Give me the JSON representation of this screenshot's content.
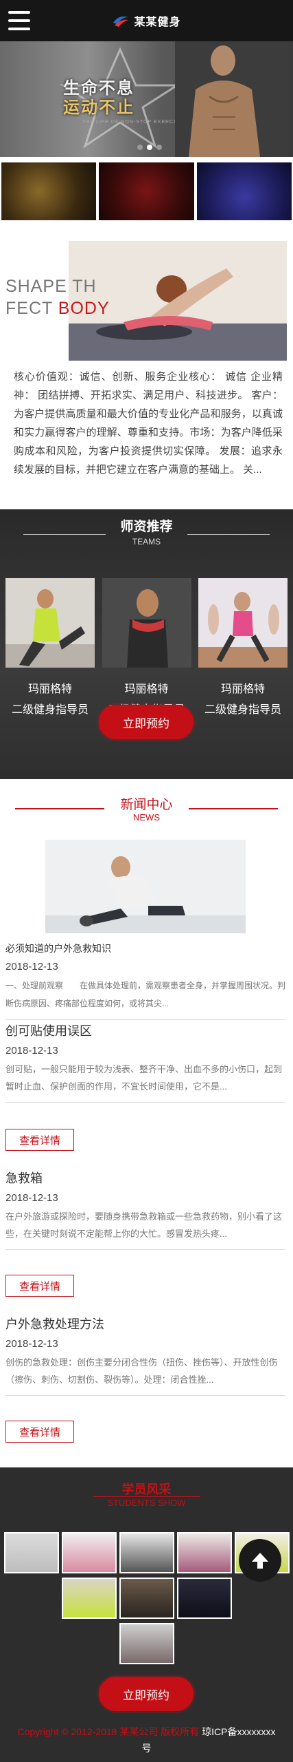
{
  "header": {
    "brand": "某某健身",
    "menu_icon": "hamburger-icon",
    "logo_icon": "swoosh-logo-icon"
  },
  "banner": {
    "title": "生命不息",
    "subtitle": "运动不止",
    "small_text": "THE LIFE OF NON-STOP EXERCISE",
    "slides": 3,
    "active_slide": 2
  },
  "shape": {
    "en_line1_a": "SHAPE TH",
    "en_line2_a": "FECT ",
    "en_line2_b": "BODY"
  },
  "about": {
    "text": "核心价值观：诚信、创新、服务企业核心： 诚信 企业精神： 团结拼搏、开拓求实、满足用户、科技进步。 客户：为客户提供高质量和最大价值的专业化产品和服务，以真诚和实力赢得客户的理解、尊重和支持。市场：为客户降低采购成本和风险，为客户投资提供切实保障。 发展：追求永续发展的目标，并把它建立在客户满意的基础上。 关..."
  },
  "teams": {
    "title": "师资推荐",
    "subtitle": "TEAMS",
    "coaches": [
      {
        "name": "玛丽格特",
        "role": "二级健身指导员"
      },
      {
        "name": "玛丽格特",
        "role": "二级健身指导员"
      },
      {
        "name": "玛丽格特",
        "role": "二级健身指导员"
      }
    ],
    "book_label": "立即预约"
  },
  "news": {
    "title": "新闻中心",
    "subtitle": "NEWS",
    "featured": {
      "title": "必须知道的户外急救知识",
      "date": "2018-12-13",
      "desc": "一、处理前观察　　在做具体处理前，需观察患者全身，并掌握周围状况。判断伤病原因、疼痛部位程度如何，或将其尖..."
    },
    "items": [
      {
        "title": "创可贴使用误区",
        "date": "2018-12-13",
        "desc": "创可贴，一般只能用于较为浅表、整齐干净、出血不多的小伤口，起到暂时止血、保护创面的作用，不宜长时间使用，它不是..."
      },
      {
        "title": "急救箱",
        "date": "2018-12-13",
        "desc": "在户外旅游或探险时，要随身携带急救箱或一些急救药物，别小看了这些，在关键时刻说不定能帮上你的大忙。感冒发热头疼..."
      },
      {
        "title": "户外急救处理方法",
        "date": "2018-12-13",
        "desc": "创伤的急救处理：创伤主要分闭合性伤（扭伤、挫伤等）、开放性创伤（擦伤、刺伤、切割伤、裂伤等）。处理：闭合性挫..."
      }
    ],
    "detail_label": "查看详情"
  },
  "students": {
    "title": "学员风采",
    "subtitle": "STUDENTS SHOW",
    "book_label": "立即预约"
  },
  "footer": {
    "copyright": "Copyright © 2012-2018 某某公司 版权所有",
    "icp_prefix": "琼ICP备xxxxxxxx",
    "icp_suffix": "号"
  },
  "back_to_top_icon": "arrow-up-icon",
  "colors": {
    "accent": "#c50f16",
    "header_bg": "#161616",
    "dark_section": "#2d2d2d"
  }
}
